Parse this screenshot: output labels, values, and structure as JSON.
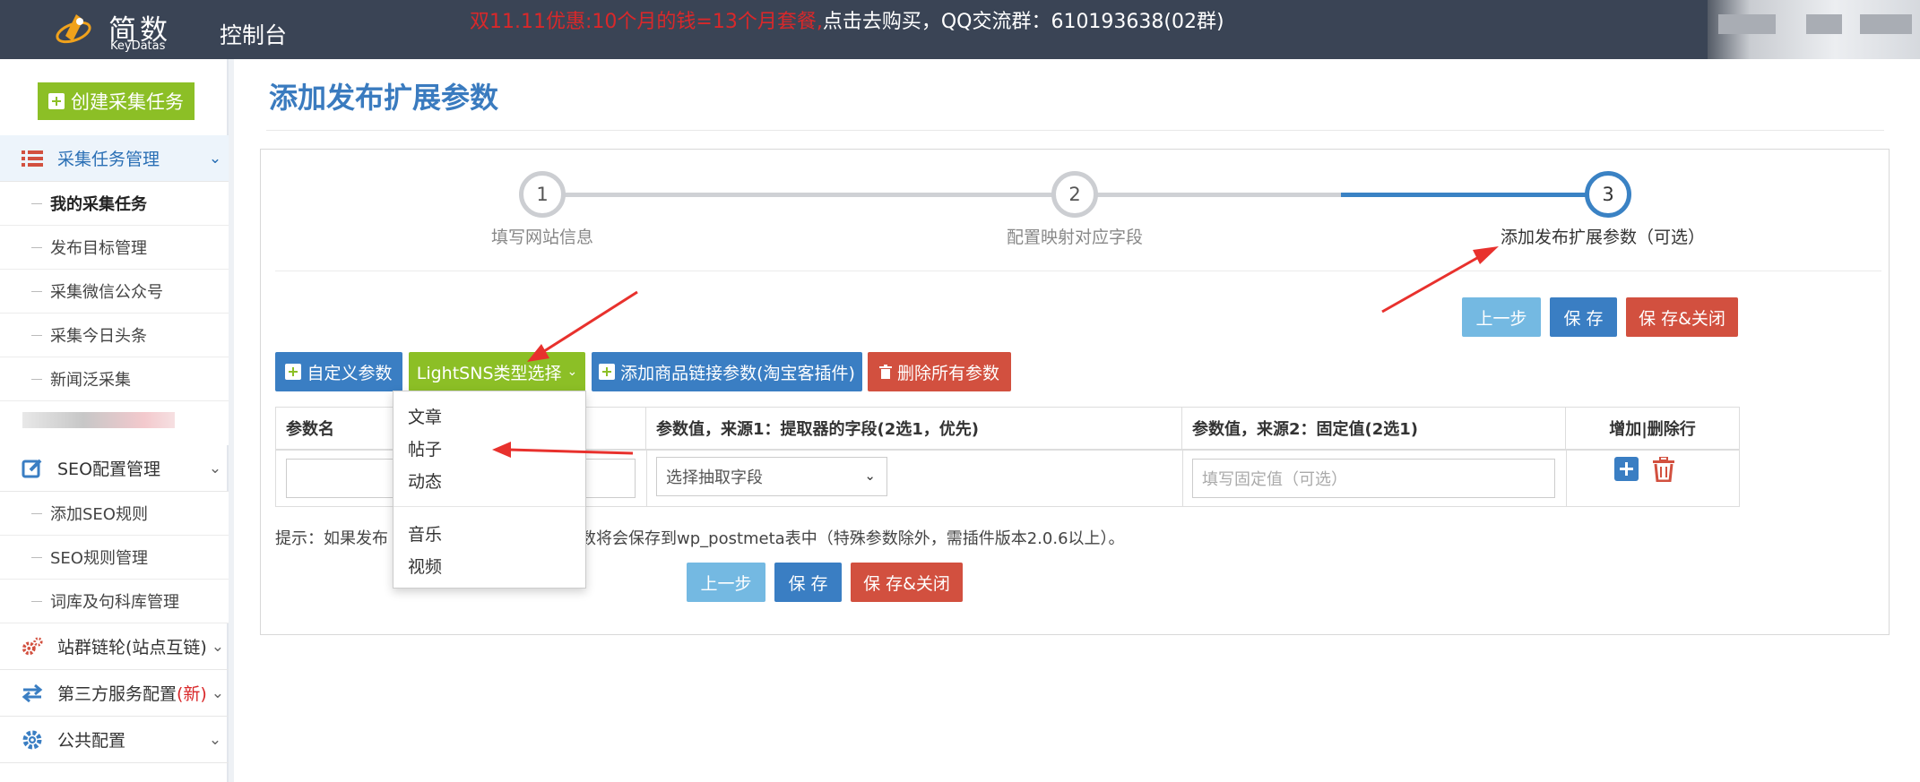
{
  "header": {
    "logo_text": "简数",
    "logo_sub": "KeyDatas",
    "console_label": "控制台",
    "promo_red": "双11.11优惠:10个月的钱=13个月套餐,",
    "promo_white": "点击去购买，QQ交流群：610193638(02群)"
  },
  "sidebar": {
    "create_task": "创建采集任务",
    "groups": [
      {
        "label": "采集任务管理",
        "icon": "list-icon"
      },
      {
        "label": "SEO配置管理",
        "icon": "edit-icon"
      },
      {
        "label": "站群链轮(站点互链)",
        "icon": "gears-icon"
      },
      {
        "label": "第三方服务配置",
        "badge": "(新)",
        "icon": "swap-icon"
      },
      {
        "label": "公共配置",
        "icon": "gear-icon"
      }
    ],
    "collect_items": [
      "我的采集任务",
      "发布目标管理",
      "采集微信公众号",
      "采集今日头条",
      "新闻泛采集"
    ],
    "seo_items": [
      "添加SEO规则",
      "SEO规则管理",
      "词库及句科库管理"
    ]
  },
  "main": {
    "title": "添加发布扩展参数",
    "steps": [
      {
        "num": "1",
        "label": "填写网站信息"
      },
      {
        "num": "2",
        "label": "配置映射对应字段"
      },
      {
        "num": "3",
        "label": "添加发布扩展参数（可选）"
      }
    ],
    "actions": {
      "prev": "上一步",
      "save": "保 存",
      "save_close": "保 存&关闭"
    },
    "toolbar": {
      "custom_param": "自定义参数",
      "lightsns_select": "LightSNS类型选择",
      "add_product_link": "添加商品链接参数(淘宝客插件)",
      "delete_all": "删除所有参数"
    },
    "table": {
      "headers": [
        "参数名",
        "参数值，来源1：提取器的字段(2选1，优先)",
        "参数值，来源2：固定值(2选1)",
        "增加|删除行"
      ],
      "select_placeholder": "选择抽取字段",
      "fixed_placeholder": "填写固定值（可选）"
    },
    "tip_start": "提示：如果发布",
    "tip_end": "展参数将会保存到wp_postmeta表中（特殊参数除外，需插件版本2.0.6以上）。",
    "dropdown": [
      "文章",
      "帖子",
      "动态",
      "音乐",
      "视频"
    ]
  },
  "colors": {
    "topbar": "#3a4455",
    "accent_blue": "#3a7ec3",
    "green": "#8cbf26",
    "red": "#d2503f",
    "arrow": "#e8312d"
  }
}
